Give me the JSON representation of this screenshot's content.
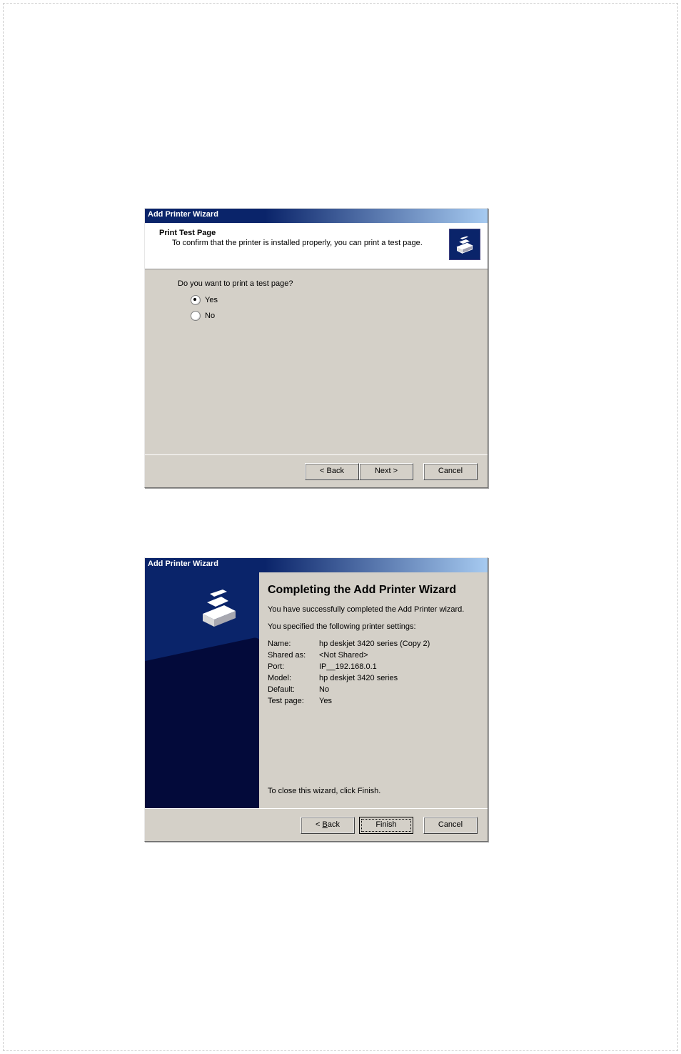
{
  "dialog1": {
    "title": "Add Printer Wizard",
    "header_title": "Print Test Page",
    "header_subtitle": "To confirm that the printer is installed properly, you can print a test page.",
    "prompt": "Do you want to print a test page?",
    "radio_yes": "Yes",
    "radio_no": "No",
    "back": "< Back",
    "next": "Next >",
    "cancel": "Cancel"
  },
  "dialog2": {
    "title": "Add Printer Wizard",
    "heading": "Completing the Add Printer Wizard",
    "line1": "You have successfully completed the Add Printer wizard.",
    "line2": "You specified the following printer settings:",
    "settings": {
      "Name:": "hp deskjet 3420 series (Copy 2)",
      "Shared as:": "<Not Shared>",
      "Port:": "IP__192.168.0.1",
      "Model:": "hp deskjet 3420 series",
      "Default:": "No",
      "Test page:": "Yes"
    },
    "close_line": "To close this wizard, click Finish.",
    "back_html": "< <u>B</u>ack",
    "finish": "Finish",
    "cancel": "Cancel"
  }
}
